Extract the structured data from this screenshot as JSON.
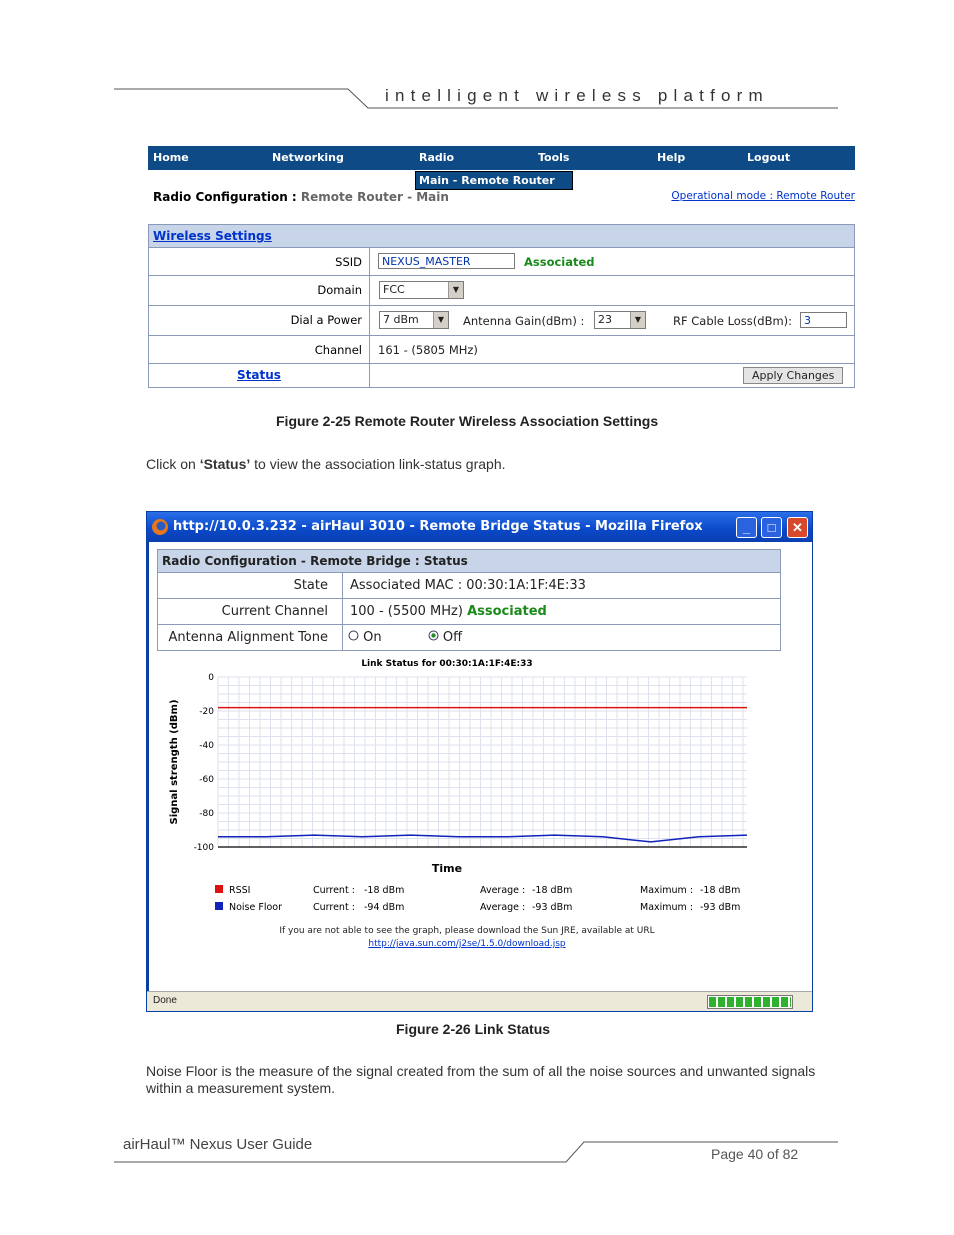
{
  "header": {
    "tagline": "intelligent   wireless   platform"
  },
  "figure1": {
    "nav": [
      "Home",
      "Networking",
      "Radio",
      "Tools",
      "Help",
      "Logout"
    ],
    "submenu": "Main - Remote Router",
    "title_label": "Radio Configuration :",
    "title_sub": "Remote Router - Main",
    "opmode_link": "Operational mode : Remote Router",
    "section_link": "Wireless Settings",
    "ssid_label": "SSID",
    "ssid_value": "NEXUS_MASTER",
    "ssid_status": "Associated",
    "domain_label": "Domain",
    "domain_value": "FCC",
    "power_label": "Dial a Power",
    "power_value": "7 dBm",
    "gain_label": "Antenna Gain(dBm) :",
    "gain_value": "23",
    "cable_label": "RF Cable Loss(dBm):",
    "cable_value": "3",
    "channel_label": "Channel",
    "channel_value": "161 - (5805 MHz)",
    "status_link": "Status",
    "apply_button": "Apply Changes",
    "caption": "Figure 2-25 Remote Router Wireless Association Settings"
  },
  "text1_pre": "Click on ",
  "text1_bold": "‘Status’",
  "text1_post": " to view the association link-status graph.",
  "figure2": {
    "window_title": "http://10.0.3.232 - airHaul 3010 - Remote Bridge Status - Mozilla Firefox",
    "panel_title": "Radio Configuration - Remote Bridge : Status",
    "state_label": "State",
    "state_value": "Associated MAC : 00:30:1A:1F:4E:33",
    "channel_label": "Current Channel",
    "channel_value": "100 - (5500 MHz)",
    "channel_status": "Associated",
    "tone_label": "Antenna Alignment Tone",
    "tone_on": "On",
    "tone_off": "Off",
    "java_note": "If you are not able to see the graph, please download the Sun JRE, available at URL",
    "java_url": "http://java.sun.com/j2se/1.5.0/download.jsp",
    "status_done": "Done",
    "caption": "Figure 2-26 Link Status",
    "colors": {
      "rssi": "#dd1111",
      "noise": "#1122bb"
    }
  },
  "chart_data": {
    "type": "line",
    "title": "Link Status for 00:30:1A:1F:4E:33",
    "xlabel": "Time",
    "ylabel": "Signal strength (dBm)",
    "ylim": [
      -100,
      0
    ],
    "yticks": [
      0,
      -20,
      -40,
      -60,
      -80,
      -100
    ],
    "grid": true,
    "series": [
      {
        "name": "RSSI",
        "values": [
          -18,
          -18,
          -18,
          -18,
          -18,
          -18,
          -18,
          -18,
          -18,
          -18,
          -18,
          -18
        ]
      },
      {
        "name": "Noise Floor",
        "values": [
          -94,
          -94,
          -93,
          -94,
          -93,
          -94,
          -94,
          -93,
          -94,
          -97,
          -94,
          -93
        ]
      }
    ],
    "legend": [
      {
        "name": "RSSI",
        "current": "-18 dBm",
        "average": "-18 dBm",
        "maximum": "-18 dBm"
      },
      {
        "name": "Noise Floor",
        "current": "-94 dBm",
        "average": "-93 dBm",
        "maximum": "-93 dBm"
      }
    ],
    "legend_labels": {
      "current": "Current :",
      "average": "Average :",
      "maximum": "Maximum :"
    }
  },
  "text2": "Noise Floor is the measure of the signal created from the sum of all the noise sources and unwanted signals within a measurement system.",
  "footer": {
    "left": "airHaul™ Nexus User Guide",
    "right": "Page 40 of 82"
  }
}
